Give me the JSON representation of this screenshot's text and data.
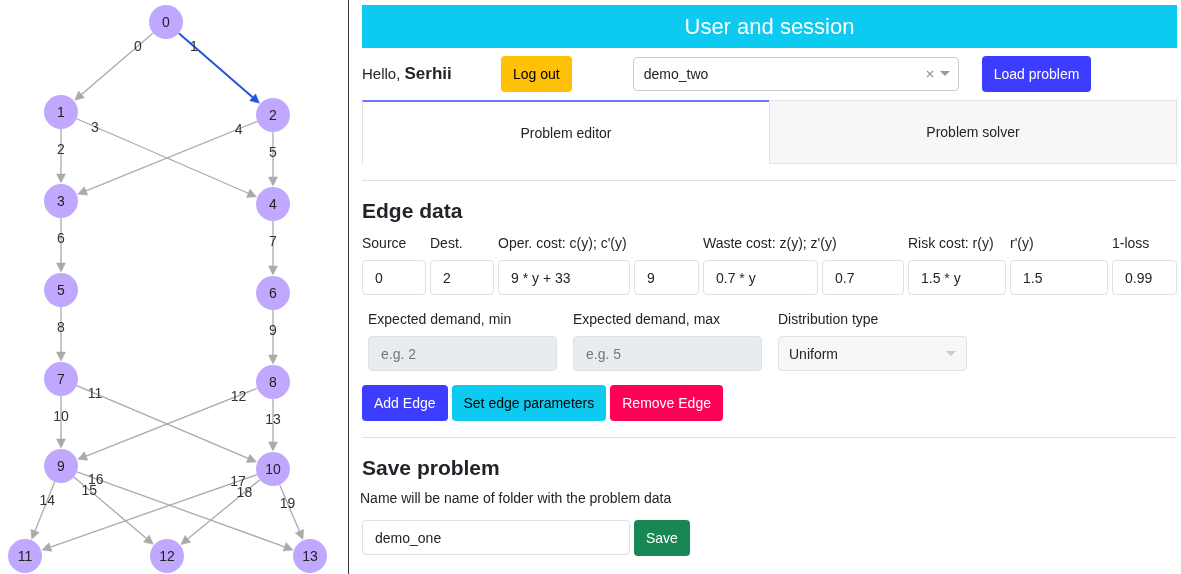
{
  "graph": {
    "nodes": [
      "0",
      "1",
      "2",
      "3",
      "4",
      "5",
      "6",
      "7",
      "8",
      "9",
      "10",
      "11",
      "12",
      "13"
    ],
    "edges": [
      {
        "label": "0",
        "selected": false
      },
      {
        "label": "1",
        "selected": true
      },
      {
        "label": "2",
        "selected": false
      },
      {
        "label": "3",
        "selected": false
      },
      {
        "label": "4",
        "selected": false
      },
      {
        "label": "5",
        "selected": false
      },
      {
        "label": "6",
        "selected": false
      },
      {
        "label": "7",
        "selected": false
      },
      {
        "label": "8",
        "selected": false
      },
      {
        "label": "9",
        "selected": false
      },
      {
        "label": "10",
        "selected": false
      },
      {
        "label": "11",
        "selected": false
      },
      {
        "label": "12",
        "selected": false
      },
      {
        "label": "13",
        "selected": false
      },
      {
        "label": "14",
        "selected": false
      },
      {
        "label": "16",
        "selected": false
      },
      {
        "label": "15",
        "selected": false
      },
      {
        "label": "17",
        "selected": false
      },
      {
        "label": "18",
        "selected": false
      },
      {
        "label": "19",
        "selected": false
      }
    ]
  },
  "header": {
    "title": "User and session"
  },
  "session": {
    "greeting": "Hello,",
    "user": "Serhii",
    "logout": "Log out",
    "problem_select": {
      "value": "demo_two"
    },
    "load": "Load problem"
  },
  "tabs": [
    {
      "label": "Problem editor",
      "selected": true
    },
    {
      "label": "Problem solver",
      "selected": false
    }
  ],
  "edge_data": {
    "title": "Edge data",
    "labels": [
      "Source",
      "Dest.",
      "Oper. cost: c(y); c'(y)",
      "Waste cost: z(y); z'(y)",
      "Risk cost: r(y)",
      "r'(y)",
      "1-loss"
    ],
    "fields": [
      "0",
      "2",
      "9 * y + 33",
      "9",
      "0.7 * y",
      "0.7",
      "1.5 * y",
      "1.5",
      "0.99"
    ],
    "demand": [
      {
        "label": "Expected demand, min",
        "placeholder": "e.g. 2",
        "disabled": true
      },
      {
        "label": "Expected demand, max",
        "placeholder": "e.g. 5",
        "disabled": true
      }
    ],
    "distribution": {
      "label": "Distribution type",
      "value": "Uniform",
      "disabled": true
    },
    "buttons": [
      {
        "label": "Add Edge",
        "kind": "primary"
      },
      {
        "label": "Set edge parameters",
        "kind": "info"
      },
      {
        "label": "Remove Edge",
        "kind": "danger"
      }
    ]
  },
  "save": {
    "title": "Save problem",
    "hint": "Name will be name of folder with the problem data",
    "name": {
      "value": "demo_one"
    },
    "button": "Save"
  }
}
